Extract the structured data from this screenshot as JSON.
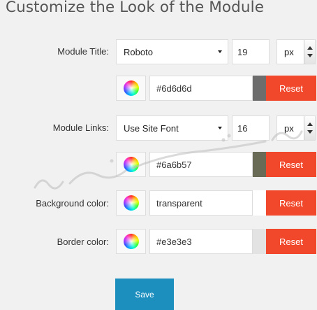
{
  "header": {
    "title": "Customize the Look of the Module"
  },
  "module_title": {
    "label": "Module Title:",
    "font": "Roboto",
    "size": "19",
    "unit": "px",
    "color_value": "#6d6d6d",
    "preview_color": "#6d6d6d",
    "reset_label": "Reset"
  },
  "module_links": {
    "label": "Module Links:",
    "font": "Use Site Font",
    "size": "16",
    "unit": "px",
    "color_value": "#6a6b57",
    "preview_color": "#6a6b57",
    "reset_label": "Reset"
  },
  "background_color": {
    "label": "Background color:",
    "value": "transparent",
    "preview_color": "#ffffff",
    "reset_label": "Reset"
  },
  "border_color": {
    "label": "Border color:",
    "value": "#e3e3e3",
    "preview_color": "#e3e3e3",
    "reset_label": "Reset"
  },
  "actions": {
    "save_label": "Save"
  },
  "colors": {
    "reset": "#f1472a",
    "save": "#1c8fbf"
  }
}
